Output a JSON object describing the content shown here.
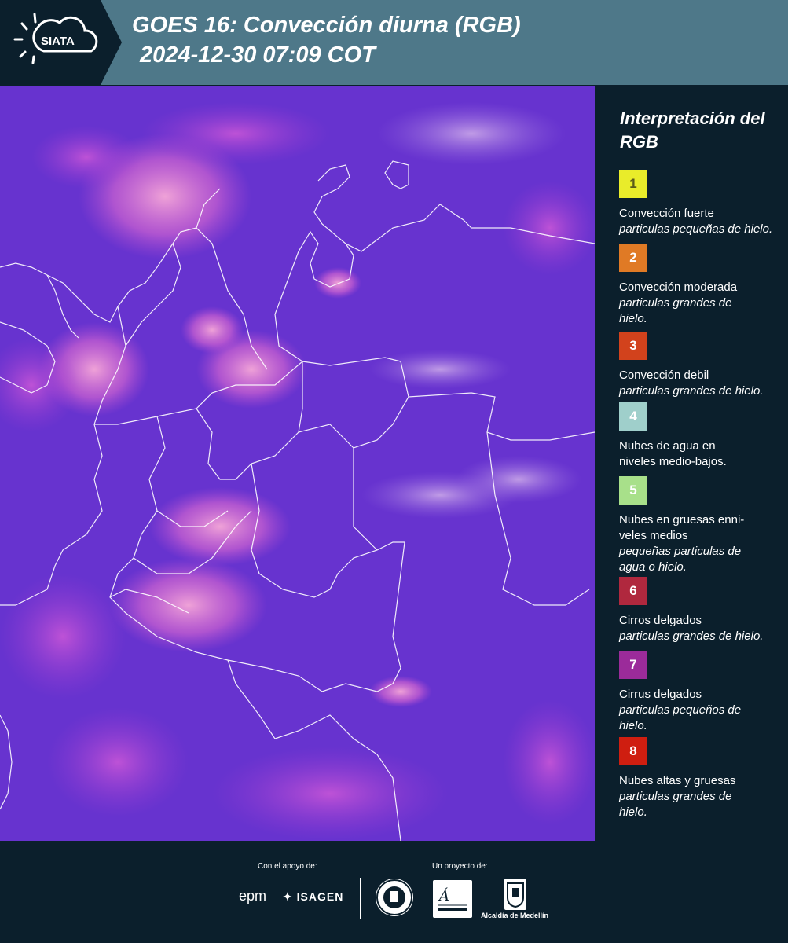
{
  "header": {
    "logo_text": "SIATA",
    "title_line1": "GOES 16: Convección diurna (RGB)",
    "title_line2": "2024-12-30 07:09 COT"
  },
  "map": {
    "image_type": "satellite-rgb-composite",
    "colors": {
      "background": "#5a2fc8",
      "cloud_pink": "#e07ad8",
      "cloud_magenta": "#c84fd0",
      "border_lines": "#ffffff"
    }
  },
  "legend": {
    "title": "Interpretación del RGB",
    "items": [
      {
        "number": "1",
        "color": "#e9ec2a",
        "text_color": "#5a5a1a",
        "name": "Convección fuerte",
        "desc": "particulas pequeñas de hielo."
      },
      {
        "number": "2",
        "color": "#e07a25",
        "text_color": "#ffffff",
        "name": "Convección moderada",
        "desc": "particulas grandes de hielo."
      },
      {
        "number": "3",
        "color": "#d2421c",
        "text_color": "#ffffff",
        "name": "Convección debil",
        "desc": "particulas grandes de hielo."
      },
      {
        "number": "4",
        "color": "#9fcfcb",
        "text_color": "#ffffff",
        "name": "Nubes de agua en niveles medio-bajos.",
        "desc": ""
      },
      {
        "number": "5",
        "color": "#a8e08a",
        "text_color": "#ffffff",
        "name": "Nubes en gruesas enni-veles medios",
        "desc": "pequeñas particulas de agua o hielo."
      },
      {
        "number": "6",
        "color": "#b0283e",
        "text_color": "#ffffff",
        "name": "Cirros delgados",
        "desc": "particulas grandes de hielo."
      },
      {
        "number": "7",
        "color": "#9b2b9a",
        "text_color": "#ffffff",
        "name": "Cirrus delgados",
        "desc": "particulas pequeños de hielo."
      },
      {
        "number": "8",
        "color": "#cf1e10",
        "text_color": "#ffffff",
        "name": "Nubes altas y gruesas",
        "desc": "particulas grandes de hielo."
      }
    ]
  },
  "footer": {
    "support_label": "Con el apoyo de:",
    "project_label": "Un proyecto de:",
    "sponsor1": "epm",
    "sponsor2": "ISAGEN",
    "partner_area": "Área Metropolitana Valle de Aburrá",
    "partner_alcaldia": "Alcaldía de Medellín"
  }
}
